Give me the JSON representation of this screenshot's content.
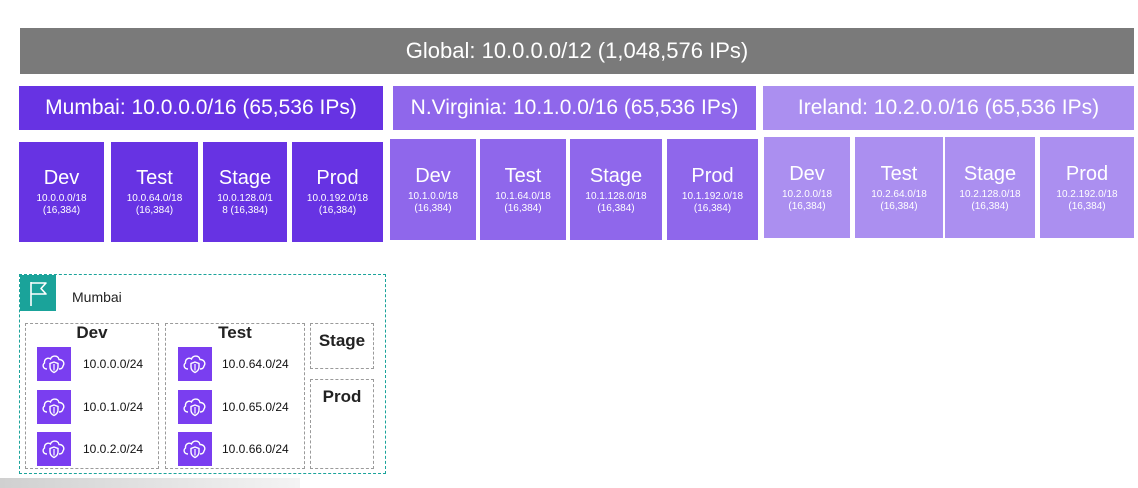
{
  "global": {
    "label": "Global: 10.0.0.0/12 (1,048,576 IPs)"
  },
  "regions": [
    {
      "label": "Mumbai: 10.0.0.0/16 (65,536 IPs)",
      "color": "#6733e3"
    },
    {
      "label": "N.Virginia: 10.1.0.0/16 (65,536 IPs)",
      "color": "#8f67eb"
    },
    {
      "label": "Ireland: 10.2.0.0/16 (65,536 IPs)",
      "color": "#ab8ff0"
    }
  ],
  "envs": {
    "mumbai": [
      {
        "name": "Dev",
        "cidr": "10.0.0.0/18",
        "count": "(16,384)"
      },
      {
        "name": "Test",
        "cidr": "10.0.64.0/18",
        "count": "(16,384)"
      },
      {
        "name": "Stage",
        "cidr": "10.0.128.0/1",
        "count": "8 (16,384)"
      },
      {
        "name": "Prod",
        "cidr": "10.0.192.0/18",
        "count": "(16,384)"
      }
    ],
    "nvirginia": [
      {
        "name": "Dev",
        "cidr": "10.1.0.0/18",
        "count": "(16,384)"
      },
      {
        "name": "Test",
        "cidr": "10.1.64.0/18",
        "count": "(16,384)"
      },
      {
        "name": "Stage",
        "cidr": "10.1.128.0/18",
        "count": "(16,384)"
      },
      {
        "name": "Prod",
        "cidr": "10.1.192.0/18",
        "count": "(16,384)"
      }
    ],
    "ireland": [
      {
        "name": "Dev",
        "cidr": "10.2.0.0/18",
        "count": "(16,384)"
      },
      {
        "name": "Test",
        "cidr": "10.2.64.0/18",
        "count": "(16,384)"
      },
      {
        "name": "Stage",
        "cidr": "10.2.128.0/18",
        "count": "(16,384)"
      },
      {
        "name": "Prod",
        "cidr": "10.2.192.0/18",
        "count": "(16,384)"
      }
    ]
  },
  "vpc": {
    "title": "Mumbai",
    "icon": "flag-icon",
    "groups": [
      {
        "title": "Dev",
        "subnets": [
          "10.0.0.0/24",
          "10.0.1.0/24",
          "10.0.2.0/24"
        ]
      },
      {
        "title": "Test",
        "subnets": [
          "10.0.64.0/24",
          "10.0.65.0/24",
          "10.0.66.0/24"
        ]
      },
      {
        "title": "Stage",
        "subnets": []
      },
      {
        "title": "Prod",
        "subnets": []
      }
    ],
    "subnet_icon": "cloud-shield-icon",
    "accent": "#1aa39a"
  }
}
